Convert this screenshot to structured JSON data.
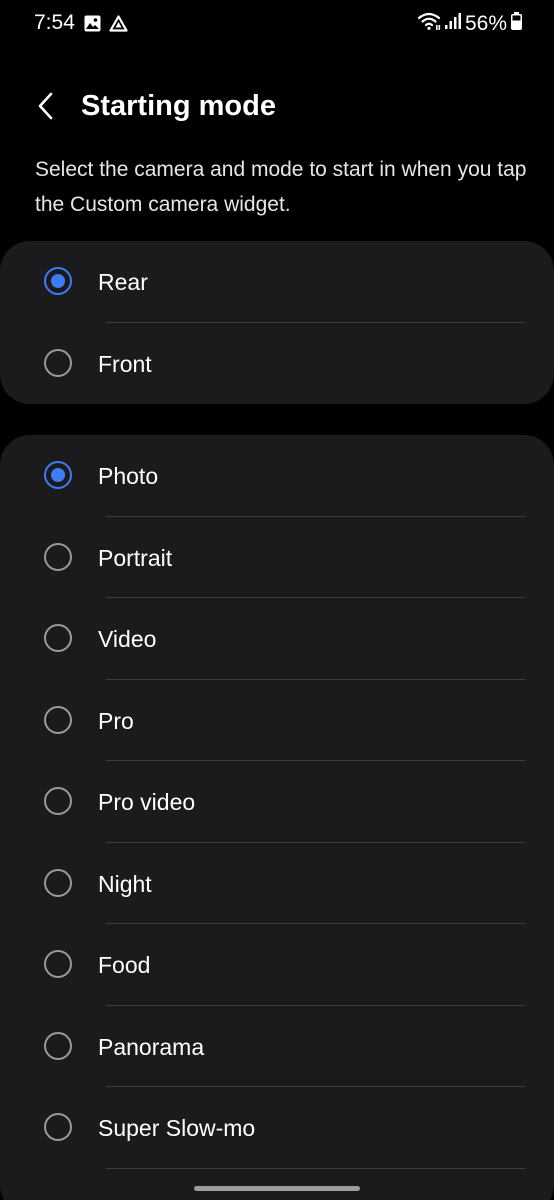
{
  "status_bar": {
    "time": "7:54",
    "battery": "56%",
    "left_icons": [
      "image-icon",
      "drive-icon"
    ],
    "right_icons": [
      "wifi-icon",
      "signal-icon",
      "battery-icon"
    ]
  },
  "header": {
    "title": "Starting mode",
    "back_icon": "chevron-left-icon"
  },
  "description": "Select the camera and mode to start in when you tap the Custom camera widget.",
  "camera_options": [
    {
      "label": "Rear",
      "selected": true
    },
    {
      "label": "Front",
      "selected": false
    }
  ],
  "mode_options": [
    {
      "label": "Photo",
      "selected": true
    },
    {
      "label": "Portrait",
      "selected": false
    },
    {
      "label": "Video",
      "selected": false
    },
    {
      "label": "Pro",
      "selected": false
    },
    {
      "label": "Pro video",
      "selected": false
    },
    {
      "label": "Night",
      "selected": false
    },
    {
      "label": "Food",
      "selected": false
    },
    {
      "label": "Panorama",
      "selected": false
    },
    {
      "label": "Super Slow-mo",
      "selected": false
    }
  ],
  "colors": {
    "accent": "#3d7bf7",
    "card_background": "#1b1b1d",
    "background": "#000000"
  }
}
